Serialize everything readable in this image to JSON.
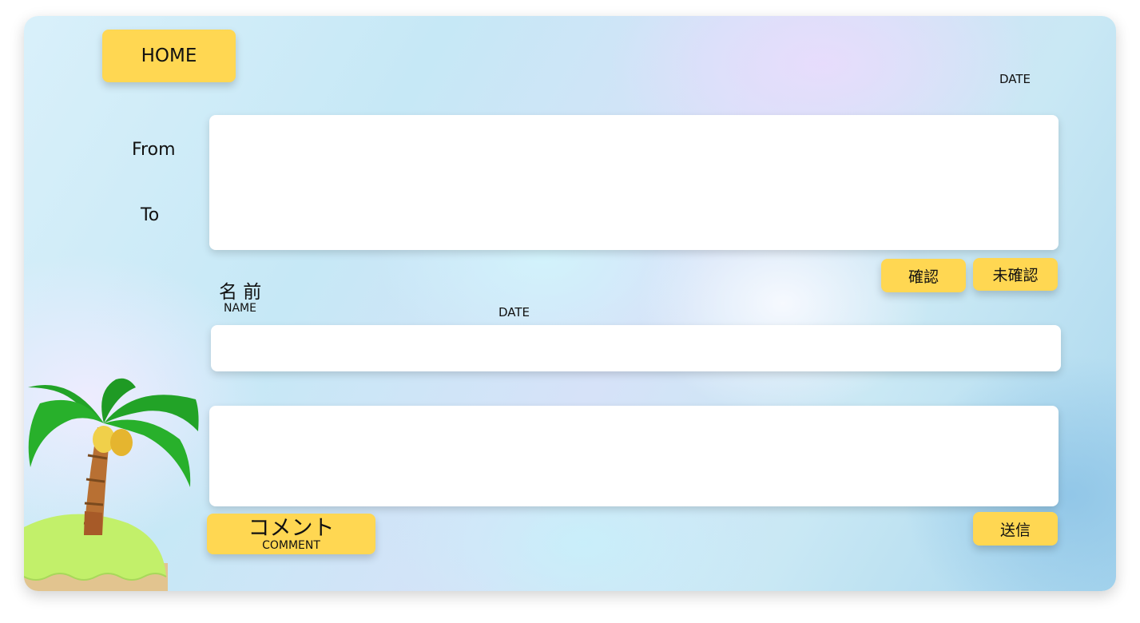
{
  "header": {
    "home_label": "HOME",
    "date_label": "DATE"
  },
  "address": {
    "from_label": "From",
    "to_label": "To",
    "from_value": "",
    "to_value": ""
  },
  "status_buttons": {
    "confirmed_label": "確認",
    "unconfirmed_label": "未確認"
  },
  "name_section": {
    "title": "名 前",
    "subtitle": "NAME",
    "date_label": "DATE",
    "name_value": ""
  },
  "comment_section": {
    "button_label": "コメント",
    "button_sublabel": "COMMENT",
    "comment_value": ""
  },
  "submit": {
    "label": "送信"
  },
  "colors": {
    "accent_yellow": "#ffd752",
    "panel_white": "#ffffff"
  },
  "icons": {
    "decoration": "palm-tree-island-icon"
  }
}
